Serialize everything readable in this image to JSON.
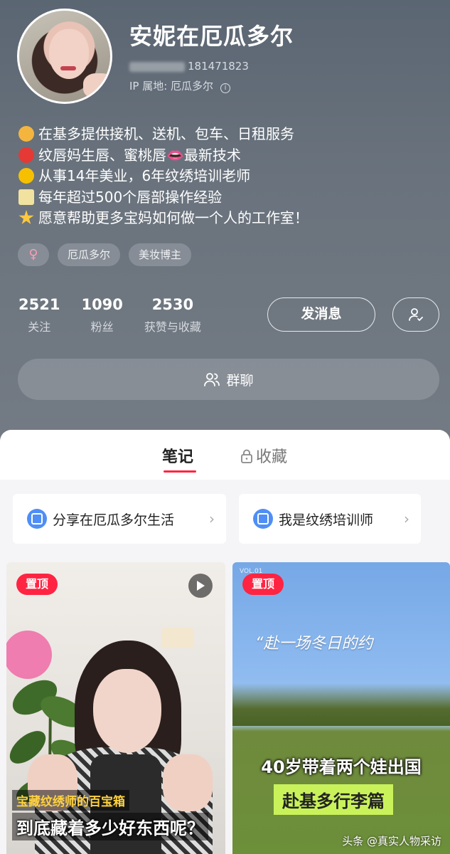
{
  "profile": {
    "nickname": "安妮在厄瓜多尔",
    "user_id": "181471823",
    "ip_location": "IP 属地: 厄瓜多尔",
    "bio": [
      {
        "emoji": "person-emoji",
        "color": "#f4b53f",
        "text": "在基多提供接机、送机、包车、日租服务"
      },
      {
        "emoji": "strawberry-emoji",
        "color": "#e53935",
        "text": "纹唇妈生唇、蜜桃唇👄最新技术"
      },
      {
        "emoji": "crown-emoji",
        "color": "#f6c000",
        "text": "从事14年美业，6年纹绣培训老师"
      },
      {
        "emoji": "memo-emoji",
        "color": "#f2e2a0",
        "text": "每年超过500个唇部操作经验"
      },
      {
        "emoji": "star-emoji",
        "color": "#ffc83d",
        "text": "愿意帮助更多宝妈如何做一个人的工作室！"
      }
    ],
    "tags": {
      "gender": "♀",
      "location": "厄瓜多尔",
      "category": "美妆博主"
    },
    "stats": [
      {
        "value": "2521",
        "label": "关注"
      },
      {
        "value": "1090",
        "label": "粉丝"
      },
      {
        "value": "2530",
        "label": "获赞与收藏"
      }
    ],
    "message_button": "发消息",
    "group_chat": "群聊"
  },
  "tabs": {
    "notes": "笔记",
    "collect": "收藏"
  },
  "collections": [
    {
      "label": "分享在厄瓜多尔生活"
    },
    {
      "label": "我是纹绣培训师"
    }
  ],
  "notes": [
    {
      "badge": "置顶",
      "caption_small": "宝藏纹绣师的百宝箱",
      "caption_big": "到底藏着多少好东西呢？"
    },
    {
      "badge": "置顶",
      "script": "“赴一场冬日的约",
      "title_white": "40岁带着两个娃出国",
      "title_green": "赴基多行李篇"
    }
  ],
  "watermark": "头条 @真实人物采访",
  "colors": {
    "accent": "#ff2442",
    "header_bg": "#5b6673"
  }
}
